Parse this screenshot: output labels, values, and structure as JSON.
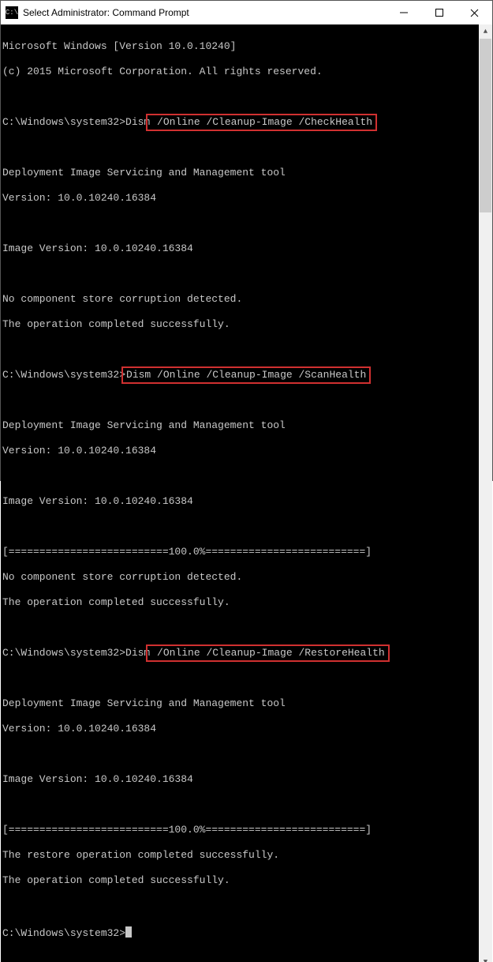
{
  "window": {
    "title": "Select Administrator: Command Prompt"
  },
  "lines": {
    "l0": "Microsoft Windows [Version 10.0.10240]",
    "l1": "(c) 2015 Microsoft Corporation. All rights reserved.",
    "l2": "",
    "l3a": "C:\\Windows\\system32>Dism",
    "l3b": " /Online /Cleanup-Image /CheckHealth",
    "l4": "",
    "l5": "Deployment Image Servicing and Management tool",
    "l6": "Version: 10.0.10240.16384",
    "l7": "",
    "l8": "Image Version: 10.0.10240.16384",
    "l9": "",
    "l10": "No component store corruption detected.",
    "l11": "The operation completed successfully.",
    "l12": "",
    "l13a": "C:\\Windows\\system32>",
    "l13b": "Dism /Online /Cleanup-Image /ScanHealth",
    "l14": "",
    "l15": "Deployment Image Servicing and Management tool",
    "l16": "Version: 10.0.10240.16384",
    "l17": "",
    "l18": "Image Version: 10.0.10240.16384",
    "l19": "",
    "l20": "[==========================100.0%==========================]",
    "l21": "No component store corruption detected.",
    "l22": "The operation completed successfully.",
    "l23": "",
    "l24a": "C:\\Windows\\system32>Dism",
    "l24b": " /Online /Cleanup-Image /RestoreHealth",
    "l25": "",
    "l26": "Deployment Image Servicing and Management tool",
    "l27": "Version: 10.0.10240.16384",
    "l28": "",
    "l29": "Image Version: 10.0.10240.16384",
    "l30": "",
    "l31": "[==========================100.0%==========================]",
    "l32": "The restore operation completed successfully.",
    "l33": "The operation completed successfully.",
    "l34": "",
    "l35": "C:\\Windows\\system32>"
  }
}
